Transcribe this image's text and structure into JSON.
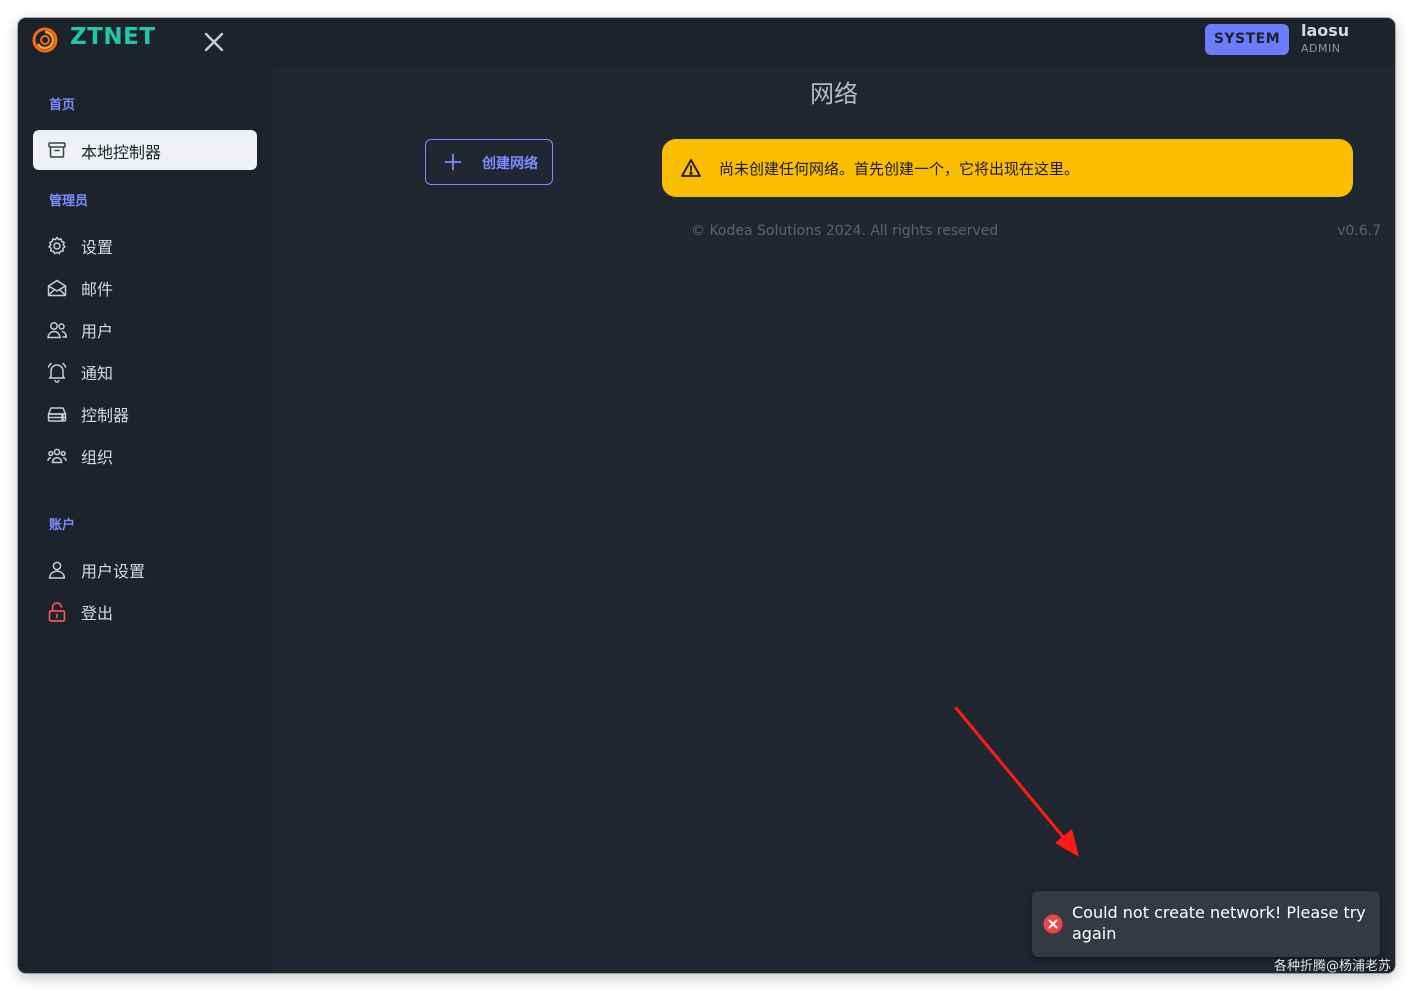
{
  "app": {
    "brand": "ZTNET",
    "logo_icon": "ztnet-logo-icon",
    "close_icon": "close-icon",
    "system_button_label": "SYSTEM",
    "user_name": "laosu",
    "user_role": "ADMIN"
  },
  "sidebar": {
    "section_home": "首页",
    "active_item": {
      "label": "本地控制器",
      "icon": "archive-box-icon"
    },
    "section_admin": "管理员",
    "admin_items": [
      {
        "label": "设置",
        "icon": "gear-icon"
      },
      {
        "label": "邮件",
        "icon": "mail-icon"
      },
      {
        "label": "用户",
        "icon": "users-icon"
      },
      {
        "label": "通知",
        "icon": "bell-icon"
      },
      {
        "label": "控制器",
        "icon": "server-icon"
      },
      {
        "label": "组织",
        "icon": "user-group-icon"
      }
    ],
    "section_account": "账户",
    "account_items": [
      {
        "label": "用户设置",
        "icon": "user-icon"
      },
      {
        "label": "登出",
        "icon": "unlock-icon"
      }
    ]
  },
  "main": {
    "title": "网络",
    "create_button_label": "创建网络",
    "alert_text": "尚未创建任何网络。首先创建一个，它将出现在这里。",
    "footer": "© Kodea Solutions 2024. All rights reserved",
    "version": "v0.6.7"
  },
  "toast": {
    "message": "Could not create network! Please try again",
    "icon": "error-x-icon"
  },
  "watermark": "各种折腾@杨浦老苏",
  "colors": {
    "brand": "#1fc8a9",
    "accent": "#7c8cff",
    "system_button": "#6b7dfa",
    "warning": "#fbbd02",
    "error": "#ef4444",
    "annotation_arrow": "#ff1a1a"
  }
}
